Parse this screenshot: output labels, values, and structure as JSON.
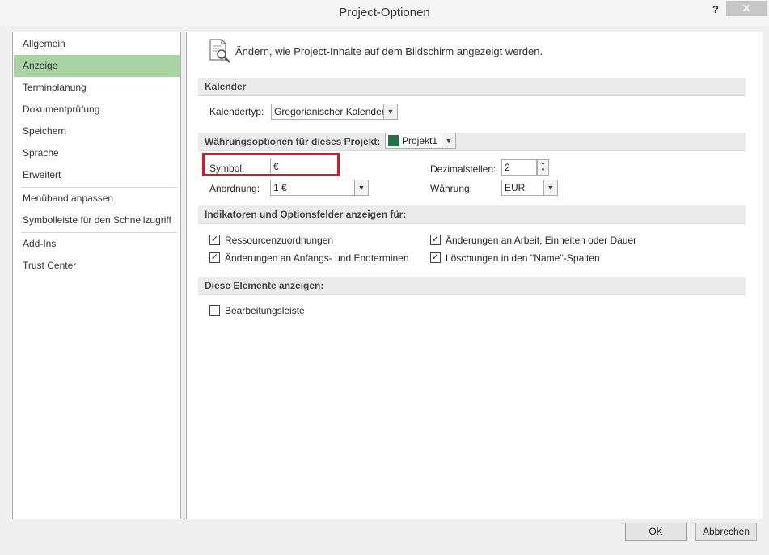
{
  "window": {
    "title": "Project-Optionen",
    "help_label": "?",
    "close_label": "✕"
  },
  "sidebar": {
    "items": [
      {
        "label": "Allgemein"
      },
      {
        "label": "Anzeige"
      },
      {
        "label": "Terminplanung"
      },
      {
        "label": "Dokumentprüfung"
      },
      {
        "label": "Speichern"
      },
      {
        "label": "Sprache"
      },
      {
        "label": "Erweitert"
      },
      {
        "label": "Menüband anpassen"
      },
      {
        "label": "Symbolleiste für den Schnellzugriff"
      },
      {
        "label": "Add-Ins"
      },
      {
        "label": "Trust Center"
      }
    ],
    "active_index": 1
  },
  "header": {
    "text": "Ändern, wie Project-Inhalte auf dem Bildschirm angezeigt werden."
  },
  "calendar": {
    "section": "Kalender",
    "type_label": "Kalendertyp:",
    "type_value": "Gregorianischer Kalender"
  },
  "currency": {
    "section": "Währungsoptionen für dieses Projekt:",
    "project_value": "Projekt1",
    "symbol_label": "Symbol:",
    "symbol_value": "€",
    "placement_label": "Anordnung:",
    "placement_value": "1 €",
    "decimals_label": "Dezimalstellen:",
    "decimals_value": "2",
    "currency_label": "Währung:",
    "currency_value": "EUR"
  },
  "indicators": {
    "section": "Indikatoren und Optionsfelder anzeigen für:",
    "options": [
      {
        "label": "Ressourcenzuordnungen",
        "checked": true
      },
      {
        "label": "Änderungen an Anfangs- und Endterminen",
        "checked": true
      },
      {
        "label": "Änderungen an Arbeit, Einheiten oder Dauer",
        "checked": true
      },
      {
        "label": "Löschungen in den ''Name''-Spalten",
        "checked": true
      }
    ]
  },
  "elements": {
    "section": "Diese Elemente anzeigen:",
    "edit_bar_label": "Bearbeitungsleiste",
    "edit_bar_checked": false
  },
  "footer": {
    "ok_label": "OK",
    "cancel_label": "Abbrechen"
  },
  "colors": {
    "active_nav": "#a8d4a3",
    "highlight_border": "#e81123",
    "project_icon": "#217346"
  }
}
